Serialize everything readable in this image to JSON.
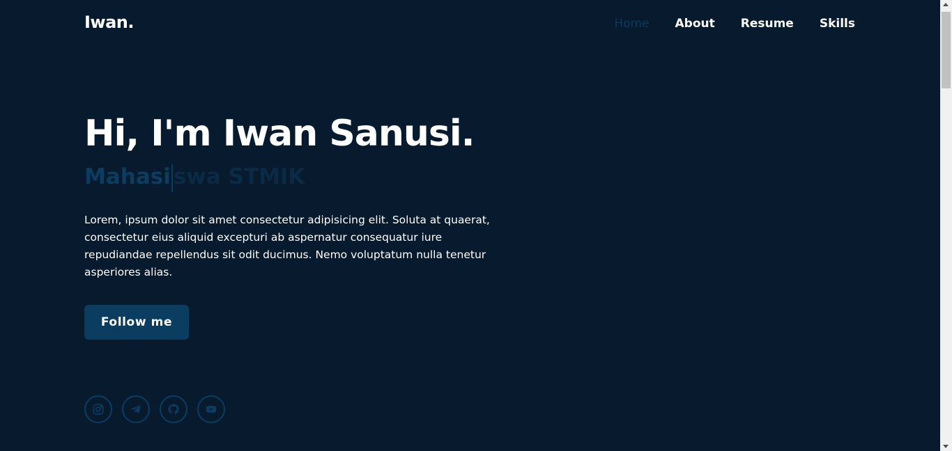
{
  "header": {
    "logo": "Iwan.",
    "nav": [
      {
        "label": "Home",
        "active": true
      },
      {
        "label": "About",
        "active": false
      },
      {
        "label": "Resume",
        "active": false
      },
      {
        "label": "Skills",
        "active": false
      }
    ]
  },
  "hero": {
    "title": "Hi, I'm Iwan Sanusi.",
    "typed_visible": "Mahasi",
    "typed_remaining": "swa STMIK",
    "description": "Lorem, ipsum dolor sit amet consectetur adipisicing elit. Soluta at quaerat, consectetur eius aliquid excepturi ab aspernatur consequatur iure repudiandae repellendus sit odit ducimus. Nemo voluptatum nulla tenetur asperiores alias.",
    "button_label": "Follow me"
  },
  "socials": [
    {
      "icon": "instagram-icon"
    },
    {
      "icon": "telegram-icon"
    },
    {
      "icon": "github-icon"
    },
    {
      "icon": "youtube-icon"
    }
  ],
  "colors": {
    "background": "#071a2e",
    "accent": "#0b3d61",
    "text": "#ffffff"
  }
}
